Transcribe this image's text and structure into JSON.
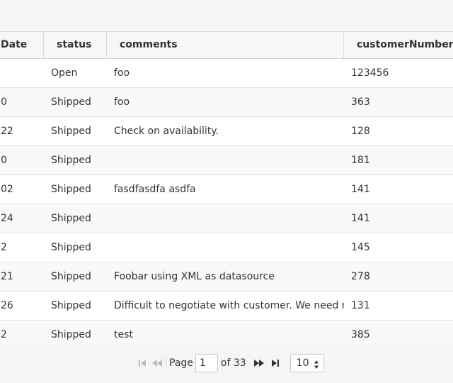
{
  "grid": {
    "columns": [
      "Date",
      "status",
      "comments",
      "customerNumber"
    ],
    "rows": [
      [
        "",
        "Open",
        "foo",
        "123456"
      ],
      [
        "0",
        "Shipped",
        "foo",
        "363"
      ],
      [
        "22",
        "Shipped",
        "Check on availability.",
        "128"
      ],
      [
        "0",
        "Shipped",
        "",
        "181"
      ],
      [
        "02",
        "Shipped",
        "fasdfasdfa asdfa",
        "141"
      ],
      [
        "24",
        "Shipped",
        "",
        "141"
      ],
      [
        "2",
        "Shipped",
        "",
        "145"
      ],
      [
        "21",
        "Shipped",
        "Foobar using XML as datasource",
        "278"
      ],
      [
        "26",
        "Shipped",
        "Difficult to negotiate with customer. We need more r",
        "131"
      ],
      [
        "2",
        "Shipped",
        "test",
        "385"
      ]
    ]
  },
  "pager": {
    "page_label": "Page",
    "current_page": "1",
    "of_label": "of 33",
    "page_size": "10",
    "icons": {
      "first": "first-page-icon",
      "prev": "prev-page-icon",
      "next": "next-page-icon",
      "last": "last-page-icon",
      "size_arrows": "updown-arrows-icon"
    }
  },
  "colors": {
    "background": "#f5f5f5",
    "row_alt": "#f9f9f9",
    "border": "#dcdcdc",
    "disabled_icon": "#bbbbbb",
    "text": "#333333"
  }
}
